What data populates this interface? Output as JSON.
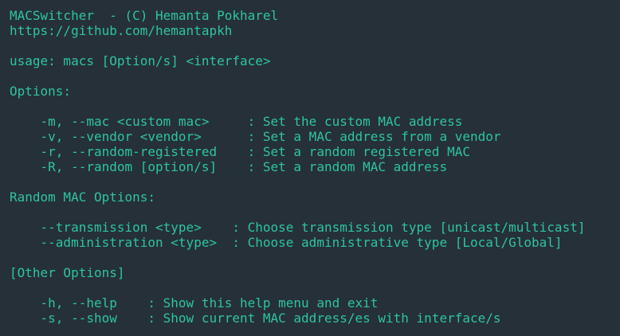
{
  "colors": {
    "background": "#263038",
    "text": "#2ec4a0"
  },
  "terminal": {
    "lines": [
      "MACSwitcher  - (C) Hemanta Pokharel",
      "https://github.com/hemantapkh",
      "",
      "usage: macs [Option/s] <interface>",
      "",
      "Options:",
      "",
      "    -m, --mac <custom mac>     : Set the custom MAC address",
      "    -v, --vendor <vendor>      : Set a MAC address from a vendor",
      "    -r, --random-registered    : Set a random registered MAC",
      "    -R, --random [option/s]    : Set a random MAC address",
      "",
      "Random MAC Options:",
      "",
      "    --transmission <type>    : Choose transmission type [unicast/multicast]",
      "    --administration <type>  : Choose administrative type [Local/Global]",
      "",
      "[Other Options]",
      "",
      "    -h, --help    : Show this help menu and exit",
      "    -s, --show    : Show current MAC address/es with interface/s"
    ]
  }
}
